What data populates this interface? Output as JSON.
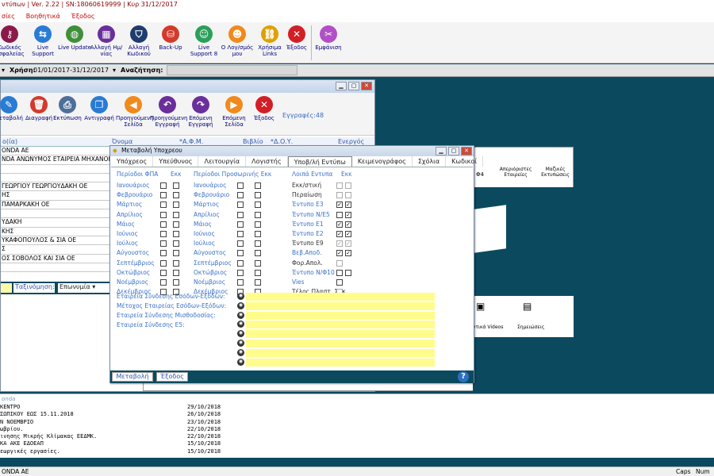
{
  "app": {
    "title": "ντύπων | Ver. 2.22 | SN:18060619999 | Κυρ 31/12/2017",
    "menu": [
      "σίες",
      "Βοηθητικά",
      "Έξοδος"
    ]
  },
  "toolbar": [
    {
      "label": "Κωδικός Ασφαλείας",
      "icon": "key-icon",
      "color": "#8b1a4a",
      "glyph": "⚷"
    },
    {
      "label": "Live Support",
      "icon": "arrows-icon",
      "color": "#2a7bd4",
      "glyph": "⇆"
    },
    {
      "label": "Live Update",
      "icon": "globe-icon",
      "color": "#3f8f3a",
      "glyph": "◍"
    },
    {
      "label": "Αλλαγή Ημ/νίας",
      "icon": "calendar-icon",
      "color": "#6a2f9a",
      "glyph": "▦"
    },
    {
      "label": "Αλλαγή Κωδικού",
      "icon": "shield-icon",
      "color": "#1f3c6e",
      "glyph": "⛉"
    },
    {
      "label": "Back-Up",
      "icon": "backup-icon",
      "color": "#d33a2c",
      "glyph": "⛁"
    },
    {
      "label": "Live Support 8",
      "icon": "person-icon",
      "color": "#2aa05a",
      "glyph": "☺"
    },
    {
      "label": "Ο Λογ/σμός μου",
      "icon": "account-icon",
      "color": "#f08a1c",
      "glyph": "☻"
    },
    {
      "label": "Χρήσιμα Links",
      "icon": "links-icon",
      "color": "#e0a000",
      "glyph": "⛓"
    },
    {
      "label": "Έξοδος",
      "icon": "close-icon",
      "color": "#d21f26",
      "glyph": "✕"
    },
    {
      "label": "Εμφάνιση",
      "icon": "appearance-icon",
      "color": "#b24fc7",
      "glyph": "✂"
    }
  ],
  "yearbar": {
    "year_label": "Χρήση:",
    "year_value": "01/01/2017-31/12/2017",
    "search_label": "Αναζήτηση:"
  },
  "clients_window": {
    "toolbar": [
      {
        "label": "Μεταβολή",
        "icon": "edit-icon",
        "color": "#2a7bd4",
        "glyph": "✎"
      },
      {
        "label": "Διαγραφή",
        "icon": "trash-icon",
        "color": "#d33a2c",
        "glyph": "🗑"
      },
      {
        "label": "Εκτύπωση",
        "icon": "print-icon",
        "color": "#4d6f9a",
        "glyph": "⎙"
      },
      {
        "label": "Αντιγραφή",
        "icon": "copy-icon",
        "color": "#2a7bd4",
        "glyph": "❐"
      },
      {
        "label": "Προηγούμενη Σελίδα",
        "icon": "prev-page-icon",
        "color": "#f08a1c",
        "glyph": "◀"
      },
      {
        "label": "Προηγούμενη Εγγραφή",
        "icon": "prev-record-icon",
        "color": "#6a2f9a",
        "glyph": "↶"
      },
      {
        "label": "Επόμενη Εγγραφή",
        "icon": "next-record-icon",
        "color": "#6a2f9a",
        "glyph": "↷"
      },
      {
        "label": "Επόμενη Σελίδα",
        "icon": "next-page-icon",
        "color": "#f08a1c",
        "glyph": "▶"
      },
      {
        "label": "Έξοδος",
        "icon": "close-icon",
        "color": "#d21f26",
        "glyph": "✕"
      }
    ],
    "records": "Εγγραφές:48",
    "columns": [
      "ο(ία)",
      "Όνομα",
      "*Α.Φ.Μ.",
      "Βιβλίο",
      "*Δ.Ο.Υ.",
      "Ενεργός"
    ],
    "rows": [
      "ONDA AE",
      "NDA ΑΝΩΝΥΜΟΣ ΕΤΑΙΡΕΙΑ ΜΗΧΑΝΟΡΓ",
      "",
      "",
      "ΓΕΩΡΓΙΟΥ ΓΕΩΡΓΙΟΥΔΑΚΗ ΟΕ",
      "ΗΣ",
      "ΠΑΜΑΡΚΑΚΗ ΟΕ",
      "",
      "ΥΔΑΚΗ",
      "ΚΗΣ",
      "ΥΚΑΦΟΠΟΥΛΟΣ & ΣΙΑ ΟΕ",
      "Σ",
      "ΟΣ ΣΟΒΟΛΟΣ ΚΑΙ ΣΙΑ ΟΕ",
      ""
    ],
    "sort_label": "Ταξινόμηση:",
    "sort_value": "Επωνυμία"
  },
  "bg_window": {
    "items": [
      "Φ4",
      "Απεριόριστες Εταιρείες",
      "Μαζικές Εκτυπώσεις"
    ],
    "lower_items": [
      "ντικά Videos",
      "Σημειώσεις"
    ]
  },
  "dialog": {
    "title": "Μεταβολή Υποχρεου",
    "tabs": [
      "Υπόχρεος",
      "Υπεύθυνος",
      "Λειτουργία",
      "Λογιστής",
      "Υποβ/λή Εντύπω",
      "Κειμενογράφος",
      "Σχόλια",
      "Κωδικοί"
    ],
    "col1_header": "Περίοδοι ΦΠΑ",
    "col1_header2": "Εκκ",
    "col2_header": "Περίοδοι Προσωρινής Εκκ",
    "col3_header": "Λοιπά Εντυπα",
    "col3_header2": "Εκκ",
    "months": [
      "Ιανουάριος",
      "Φεβρουάριο",
      "Μάρτιος",
      "Απρίλιος",
      "Μάιος",
      "Ιούνιος",
      "Ιούλιος",
      "Αύγουστος",
      "Σεπτέμβριος",
      "Οκτώβριος",
      "Νοέμβριος",
      "Δεκέμβριος"
    ],
    "forms": [
      {
        "label": "Εκκ/στική",
        "c1": false,
        "c2": false,
        "enabled": false
      },
      {
        "label": "Περαίωση",
        "c1": false,
        "c2": false,
        "enabled": false
      },
      {
        "label": "Έντυπο Ε3",
        "c1": true,
        "c2": true,
        "enabled": true
      },
      {
        "label": "Έντυπο Ν/Ε5",
        "c1": false,
        "c2": true,
        "enabled": true
      },
      {
        "label": "Έντυπο Ε1",
        "c1": true,
        "c2": true,
        "enabled": true
      },
      {
        "label": "Έντυπο Ε2",
        "c1": true,
        "c2": true,
        "enabled": true
      },
      {
        "label": "Έντυπο Ε9",
        "c1": true,
        "c2": true,
        "enabled": false
      },
      {
        "label": "Βεβ.Αποδ.",
        "c1": true,
        "c2": true,
        "enabled": true
      },
      {
        "label": "Φορ.Απολ.",
        "c1": false,
        "c2": null,
        "enabled": false
      },
      {
        "label": "Έντυπο Ν/Φ10",
        "c1": false,
        "c2": false,
        "enabled": true
      },
      {
        "label": "Vies",
        "c1": false,
        "c2": null,
        "enabled": true
      },
      {
        "label": "Τέλος Πλαστ. Σακ.",
        "c1": false,
        "c2": null,
        "enabled": false
      }
    ],
    "links": [
      "Εταιρεία Σύνδεσης Εσόδων-Εξόδων:",
      "Μέτοχος Εταιρείας Εσόδων-Εξόδων:",
      "Εταιρεία Σύνδεσης Μισθοδοσίας:",
      "Εταιρεία Σύνδεσης Ε5:"
    ],
    "save_label": "Μεταβολή",
    "exit_label": "Έξοδος",
    "help_label": "?"
  },
  "log": {
    "title": "onda",
    "rows": [
      {
        "text": "ΚΕΝΤΡΟ",
        "date": "29/10/2018"
      },
      {
        "text": "ΣΩΠΙΚΟΥ ΕΩΣ 15.11.2018",
        "date": "26/10/2018"
      },
      {
        "text": "Ν ΝΟΕΜΒΡΙΟ",
        "date": "23/10/2018"
      },
      {
        "text": "ωβρίου.",
        "date": "22/10/2018"
      },
      {
        "text": "ινησης Μικρής Κλίμακας ΕΕΔΜΚ.",
        "date": "22/10/2018"
      },
      {
        "text": "ΚΑ ΑΚΕ ΕΔΟΕΑΠ",
        "date": "15/10/2018"
      },
      {
        "text": "εωργικές εργασίες.",
        "date": "15/10/2018"
      }
    ]
  },
  "status": {
    "company": "ONDA AE",
    "caps": "Caps",
    "num": "Num"
  }
}
